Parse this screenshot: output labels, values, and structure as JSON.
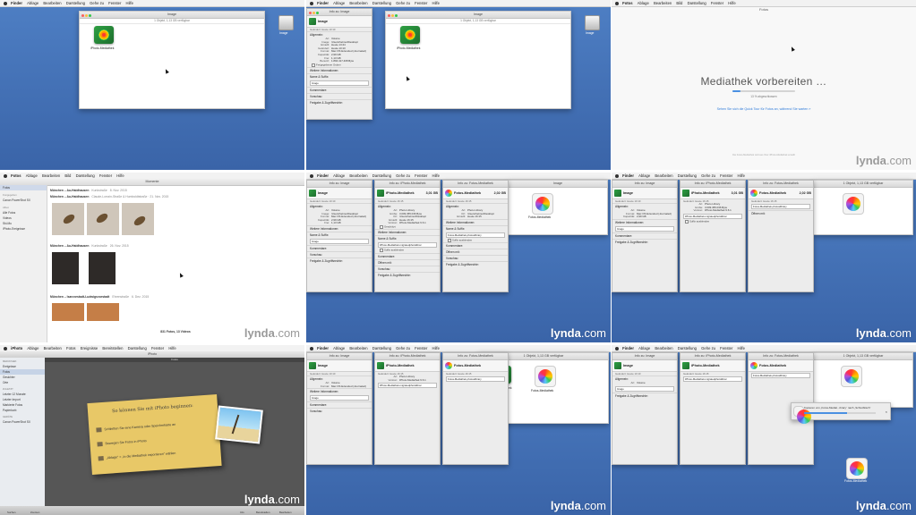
{
  "watermark": {
    "brand": "lynda",
    "suffix": ".com"
  },
  "menus": {
    "finder": [
      "Finder",
      "Ablage",
      "Bearbeiten",
      "Darstellung",
      "Gehe zu",
      "Fenster",
      "Hilfe"
    ],
    "fotos": [
      "Fotos",
      "Ablage",
      "Bearbeiten",
      "Bild",
      "Darstellung",
      "Fenster",
      "Hilfe"
    ],
    "iphoto": [
      "iPhoto",
      "Ablage",
      "Bearbeiten",
      "Fotos",
      "Ereignisse",
      "Bereitstellen",
      "Darstellung",
      "Fenster",
      "Hilfe"
    ]
  },
  "finder": {
    "window_title": "Image",
    "status": "1 Objekt, 1,13 GB verfügbar",
    "library_icon_label": "iPhoto-Mediathek",
    "drive_label": "Image"
  },
  "info_panel": {
    "title": "Info zu: Image",
    "name": "Image",
    "date": "Geändert: Heute 10:10",
    "general_section": "Allgemein:",
    "rows": [
      {
        "k": "Art:",
        "v": "Volume"
      },
      {
        "k": "Image:",
        "v": "/Users/helmut/Desktop/"
      },
      {
        "k": "Erstellt:",
        "v": "Heute 13:44"
      },
      {
        "k": "Geändert:",
        "v": "Heute 10:10"
      },
      {
        "k": "Format:",
        "v": "Mac OS Extended (Journaled)"
      },
      {
        "k": "Kapazität:",
        "v": "2,99 GB"
      },
      {
        "k": "Frei:",
        "v": "1,13 GB"
      },
      {
        "k": "Benutzt:",
        "v": "1.894.417.408 Byte"
      }
    ],
    "shared": "Freigegebener Ordner",
    "more_info": "Weitere Informationen:",
    "name_ext": "Name & Suffix:",
    "name_value": "Image",
    "comments": "Kommentare:",
    "preview": "Vorschau:",
    "sharing": "Freigabe & Zugriffsrechte:"
  },
  "info_mediathek": {
    "title": "Info zu: iPhoto-Mediathek",
    "name": "iPhoto-Mediathek",
    "size": "3,01 GB",
    "date": "Geändert: Heute 16:15",
    "rows": [
      {
        "k": "Art:",
        "v": "Photo Library"
      },
      {
        "k": "Größe:",
        "v": "3.009.455.036 Byte"
      },
      {
        "k": "Ort:",
        "v": "/Users/helmut/Desktop/"
      },
      {
        "k": "Erstellt:",
        "v": "Heute 16:15"
      },
      {
        "k": "Geändert:",
        "v": "Heute 16:15"
      },
      {
        "k": "Version:",
        "v": "iPhoto-Mediathek 9.6.1"
      }
    ],
    "name_value": "iPhoto-Mediathek.migratedphotolibrar",
    "hide_ext": "Suffix ausblenden",
    "locked": "Geschützt"
  },
  "info_fotos": {
    "title": "Info zu: Fotos-Mediathek",
    "name": "Fotos-Mediathek",
    "size": "2,02 GB",
    "date": "Geändert: Heute 16:15",
    "name_value": "Fotos-Mediathek.photoslibrary",
    "open_with": "Öffnen mit:",
    "comments": "Kommentare:"
  },
  "fotos_prep": {
    "window_title": "Fotos",
    "heading": "Mediathek vorbereiten …",
    "progress_text": "13 % abgeschlossen",
    "progress": 0.13,
    "tour_link": "Sehen Sie sich die Quick Tour für Fotos an, während Sie warten »",
    "footnote": "Die Fotos-Mediathek wird aus Ihrer iPhoto-Mediathek erstellt"
  },
  "fotos_app": {
    "toolbar_title": "Momente",
    "sidebar": {
      "top": [
        "Fotos"
      ],
      "shared_header": "Freigegeben",
      "shared": [
        "Canon PowerShot SX"
      ],
      "albums_header": "Alben",
      "albums": [
        "Alle Fotos",
        "Videos",
        "Ski-Mu",
        "iPhoto-Ereignisse"
      ]
    },
    "moments": [
      {
        "title": "München – Au-Haidhausen",
        "place": "Kunkstraße",
        "date": "8. Nov. 2015"
      },
      {
        "title": "München – Au-Haidhausen",
        "place": "Kunkstraße",
        "date": "26. Nov. 2015"
      },
      {
        "title": "München – Isarvorstadt-Ludwigsvorstadt",
        "place": "Ehrenstraße",
        "date": "6. Dez. 2015"
      }
    ],
    "subtitle_1": "Claude-Lorrain-Straße & Humboldtstraße · 21. Nov. 2015",
    "count": "831 Fotos, 13 Videos"
  },
  "iphoto_app": {
    "title": "iPhoto",
    "section": "Fotos",
    "sidebar": {
      "lib_header": "MEDIATHEK",
      "lib": [
        "Ereignisse",
        "Fotos",
        "Gesichter",
        "Orte"
      ],
      "recent_header": "ZULETZT",
      "recent": [
        "Letzter 12 Monate",
        "Letzter Import",
        "Markierte Fotos",
        "Papierkorb"
      ],
      "devices_header": "GERÄTE",
      "devices": [
        "Canon PowerShot SX"
      ]
    },
    "welcome_title": "So können Sie mit iPhoto beginnen:",
    "steps": [
      "Schließen Sie eine Kamera oder Speicherkarte an",
      "Bewegen Sie Fotos in iPhoto",
      "„Ablage“ > „In die Mediathek importieren“ wählen"
    ],
    "bottom": [
      "Suchen",
      "Zoomen",
      "Info",
      "Bereitstellen",
      "Bearbeiten"
    ]
  },
  "copy_dialog": {
    "text": "Kopieren von „Fotos-Mediat...ibrary“ nach „Schreibtisch“",
    "progress": 0.6
  },
  "desktop_item": {
    "label": "Fotos-Mediathek"
  }
}
